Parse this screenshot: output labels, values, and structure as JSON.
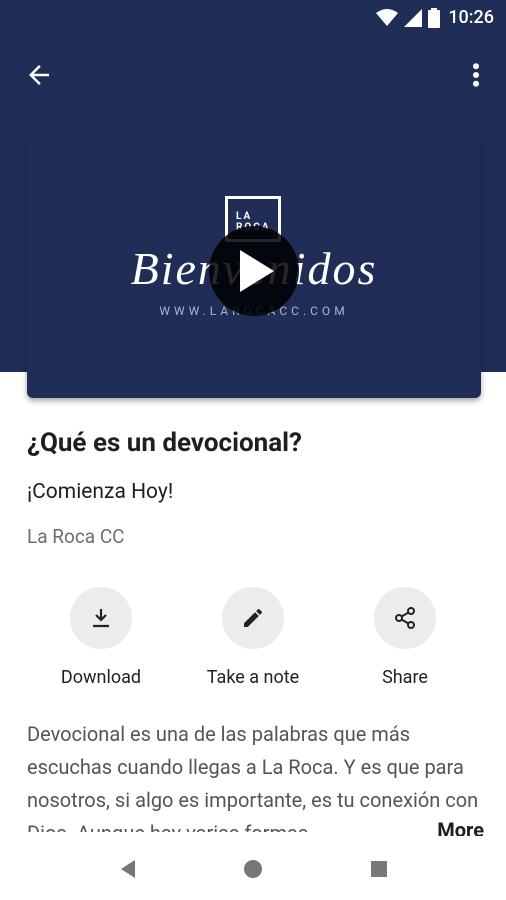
{
  "status_bar": {
    "time": "10:26"
  },
  "video": {
    "logo_text": "LA ROCA",
    "welcome_text": "Bienvenidos",
    "site_text": "WWW.LAROCACC.COM"
  },
  "episode": {
    "title": "¿Qué es un devocional?",
    "subtitle": "¡Comienza Hoy!",
    "author": "La Roca CC"
  },
  "actions": [
    {
      "label": "Download",
      "icon": "download-icon"
    },
    {
      "label": "Take a note",
      "icon": "pencil-icon"
    },
    {
      "label": "Share",
      "icon": "share-icon"
    }
  ],
  "description": {
    "text": "Devocional es una de las palabras que más escuchas cuando llegas a La Roca. Y es que para nosotros, si algo es importante, es tu conexión con Dios. Aunque hay varias formas",
    "more_label": "More"
  },
  "colors": {
    "header": "#1f2d57",
    "action_bg": "#ececec"
  }
}
